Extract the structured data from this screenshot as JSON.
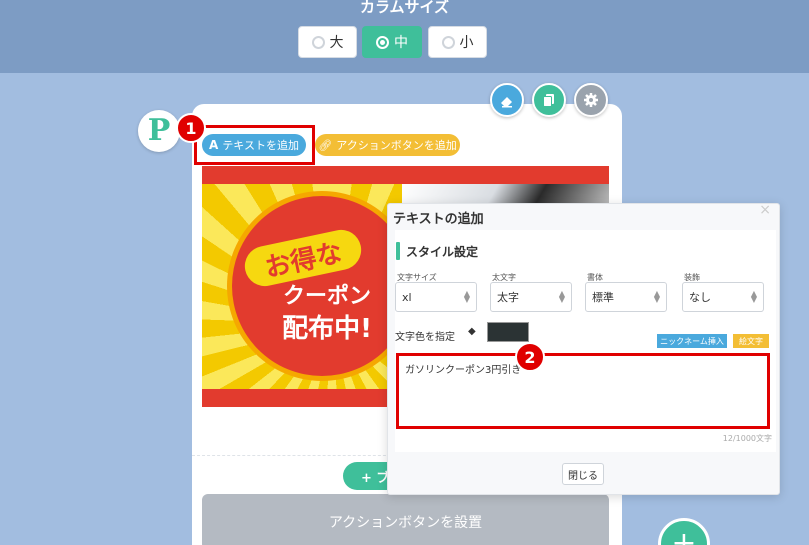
{
  "column_size": {
    "title": "カラムサイズ",
    "options": [
      {
        "label": "大",
        "selected": false
      },
      {
        "label": "中",
        "selected": true
      },
      {
        "label": "小",
        "selected": false
      }
    ]
  },
  "toolbar": {
    "icons": [
      "eraser-icon",
      "copy-icon",
      "gear-icon"
    ],
    "colors": {
      "eraser": "#4aa9dd",
      "copy": "#3fbf9a",
      "gear": "#9aa3ad"
    }
  },
  "logo": {
    "letter": "P"
  },
  "tabs": {
    "add_text": "テキストを追加",
    "add_action": "アクションボタンを追加"
  },
  "coupon": {
    "line1": "お得な",
    "line2": "クーポン",
    "line3": "配布中!"
  },
  "badges": {
    "one": "1",
    "two": "2"
  },
  "editor": {
    "add_block_label": "+ ブ",
    "action_bar_label": "アクションボタンを設置",
    "fab_label": "+"
  },
  "dialog": {
    "title": "テキストの追加",
    "close_x": "×",
    "section_title": "スタイル設定",
    "fields": [
      {
        "label": "文字サイズ",
        "value": "xl"
      },
      {
        "label": "太文字",
        "value": "太字"
      },
      {
        "label": "書体",
        "value": "標準"
      },
      {
        "label": "装飾",
        "value": "なし"
      }
    ],
    "color_label": "文字色を指定",
    "color_value": "#2b3334",
    "nickname_button": "ニックネーム挿入",
    "emoji_button": "絵文字",
    "text_value": "ガソリンクーポン3円引き",
    "counter": "12/1000文字",
    "close_button": "閉じる"
  },
  "colors": {
    "accent": "#3fbf9a",
    "highlight": "#e00000",
    "background": "#a2bde0"
  }
}
